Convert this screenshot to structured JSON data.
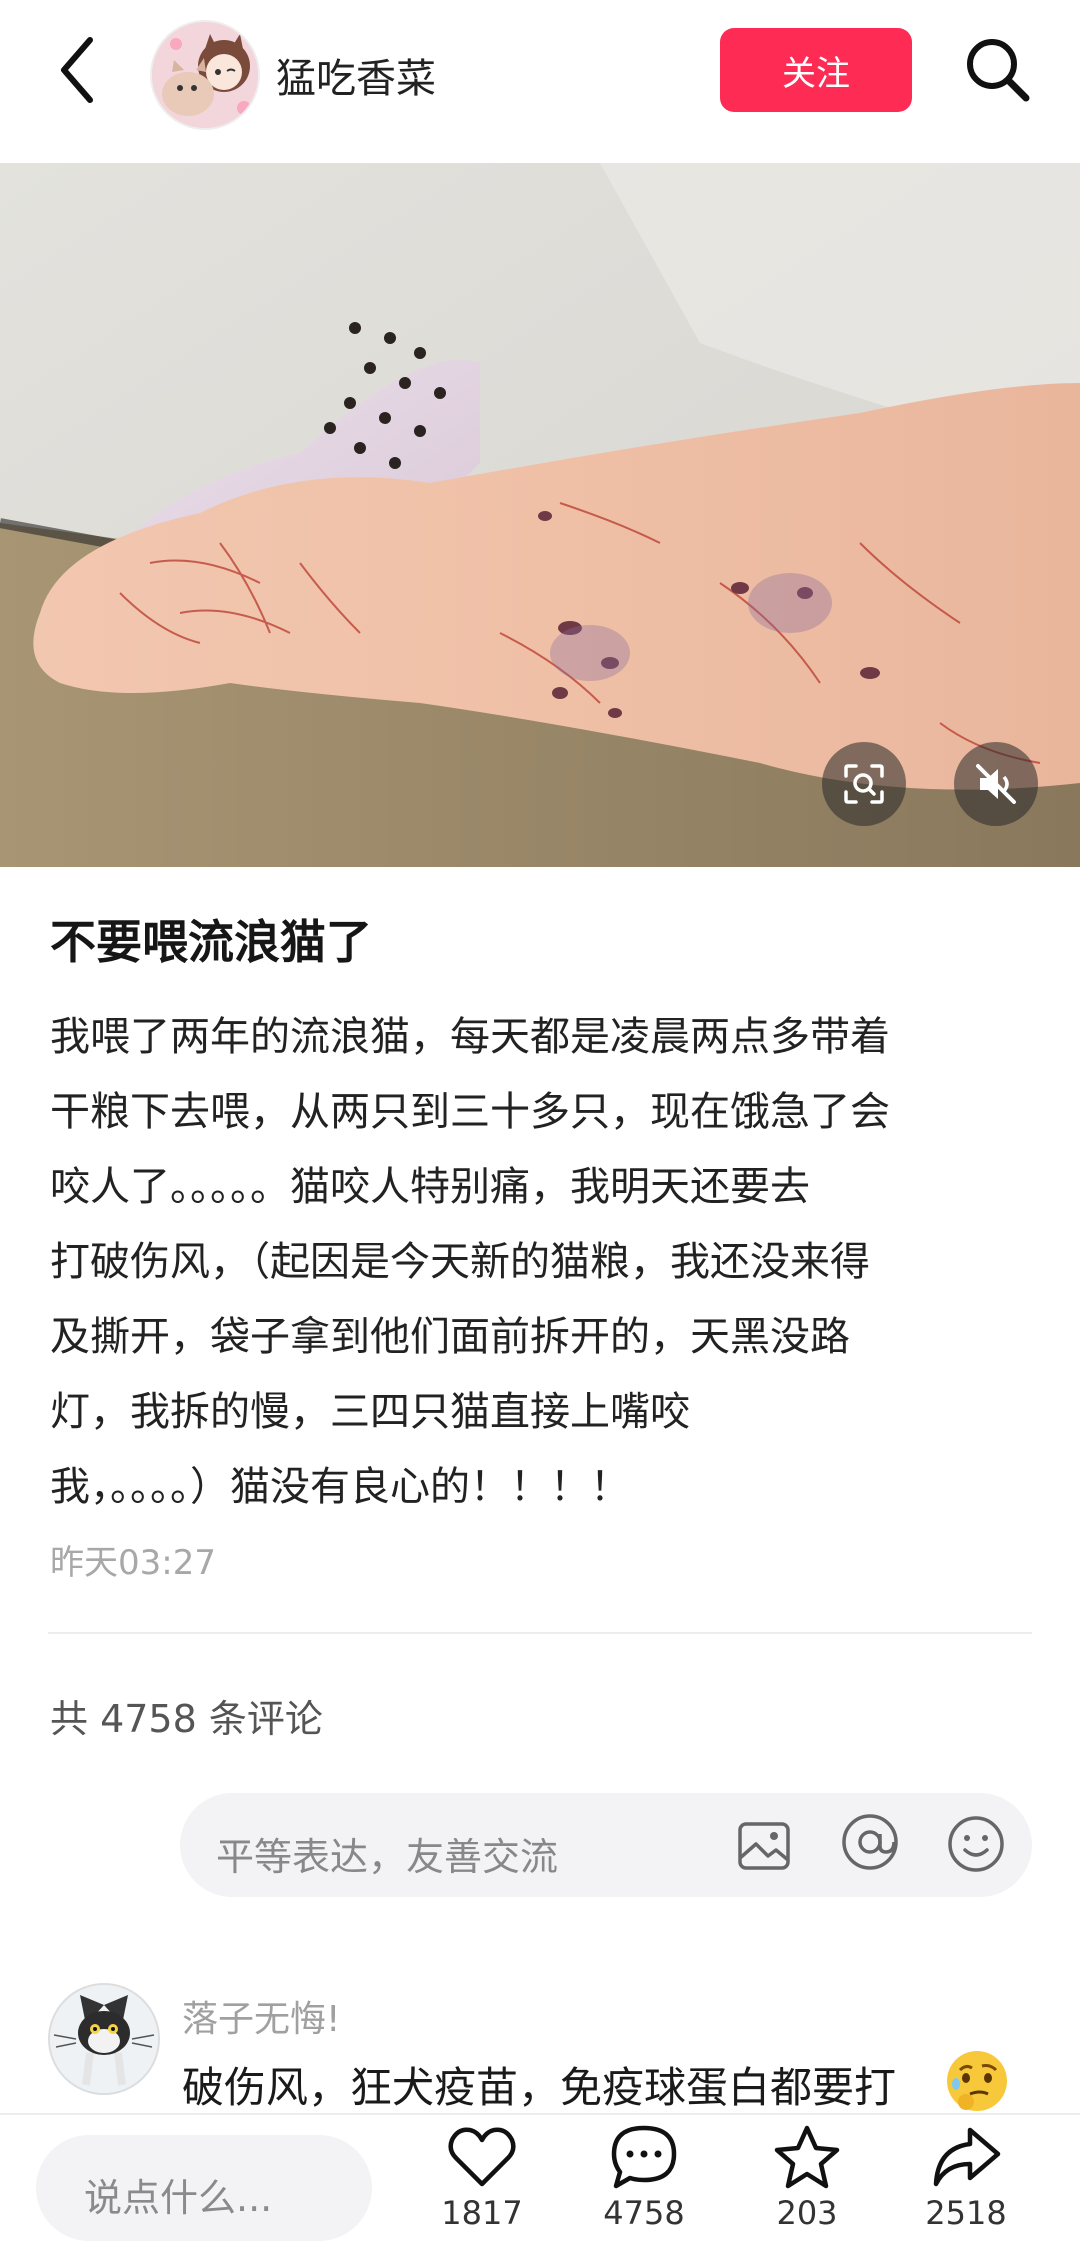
{
  "header": {
    "author_name": "猛吃香菜",
    "follow_label": "关注",
    "back_icon": "chevron-left-icon",
    "search_icon": "search-icon"
  },
  "photo": {
    "scan_icon": "scan-icon",
    "mute_icon": "volume-mute-icon"
  },
  "post": {
    "title": "不要喂流浪猫了",
    "body_lines": [
      "我喂了两年的流浪猫，每天都是凌晨两点多带着",
      "干粮下去喂，从两只到三十多只，现在饿急了会",
      "咬人了。。。。。猫咬人特别痛，我明天还要去",
      "打破伤风，（起因是今天新的猫粮，我还没来得",
      "及撕开，袋子拿到他们面前拆开的，天黑没路",
      "灯，我拆的慢，三四只猫直接上嘴咬",
      "我，。。。。）猫没有良心的！！！！"
    ],
    "time": "昨天03:27"
  },
  "comments": {
    "count_text": "共 4758 条评论",
    "input_placeholder": "平等表达，友善交流",
    "first": {
      "username": "落子无悔!",
      "text": "破伤风，狂犬疫苗，免疫球蛋白都要打"
    }
  },
  "bottom": {
    "say_placeholder": "说点什么...",
    "likes": "1817",
    "comments": "4758",
    "collects": "203",
    "shares": "2518"
  },
  "colors": {
    "accent": "#fe2c55",
    "muted": "#a8a8a8"
  }
}
